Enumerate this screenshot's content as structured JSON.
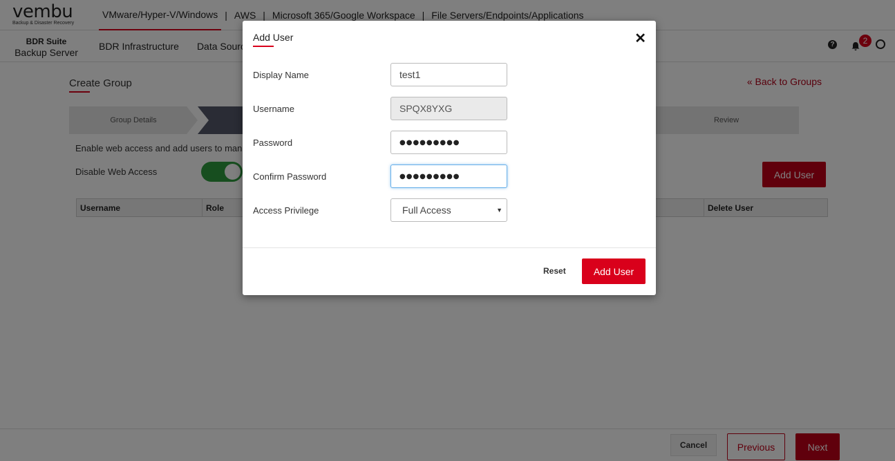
{
  "brand": {
    "wordmark": "vembu",
    "tagline": "Backup & Disaster Recovery"
  },
  "top_nav": {
    "items": [
      "VMware/Hyper-V/Windows",
      "AWS",
      "Microsoft 365/Google Workspace",
      "File Servers/Endpoints/Applications"
    ],
    "separator": "|",
    "active_index": 0
  },
  "product": {
    "line1": "BDR Suite",
    "line2": "Backup Server"
  },
  "sub_nav": {
    "items": [
      "BDR Infrastructure",
      "Data Source"
    ]
  },
  "header": {
    "notification_count": "2",
    "help_glyph": "?"
  },
  "page": {
    "title": "Create Group",
    "back_link": "« Back to Groups",
    "steps": [
      "Group Details",
      "",
      "",
      "Review"
    ],
    "web_access_text": "Enable web access and add users to manage",
    "disable_web_access_label": "Disable Web Access",
    "disable_web_access_on": true,
    "add_user_button": "Add User",
    "table_headers": [
      "Username",
      "Role",
      "Delete User"
    ]
  },
  "footer": {
    "cancel": "Cancel",
    "previous": "Previous",
    "next": "Next"
  },
  "modal": {
    "title": "Add User",
    "close_glyph": "✕",
    "display_name_label": "Display Name",
    "display_name_value": "test1",
    "username_label": "Username",
    "username_value": "SPQX8YXG",
    "password_label": "Password",
    "password_value": "●●●●●●●●●",
    "confirm_password_label": "Confirm Password",
    "confirm_password_value": "●●●●●●●●●",
    "access_privilege_label": "Access Privilege",
    "access_privilege_value": "Full Access",
    "reset_button": "Reset",
    "add_user_button": "Add User"
  },
  "colors": {
    "accent": "#d9001b",
    "toggle_on": "#2e9c3e",
    "active_step": "#55586a"
  }
}
